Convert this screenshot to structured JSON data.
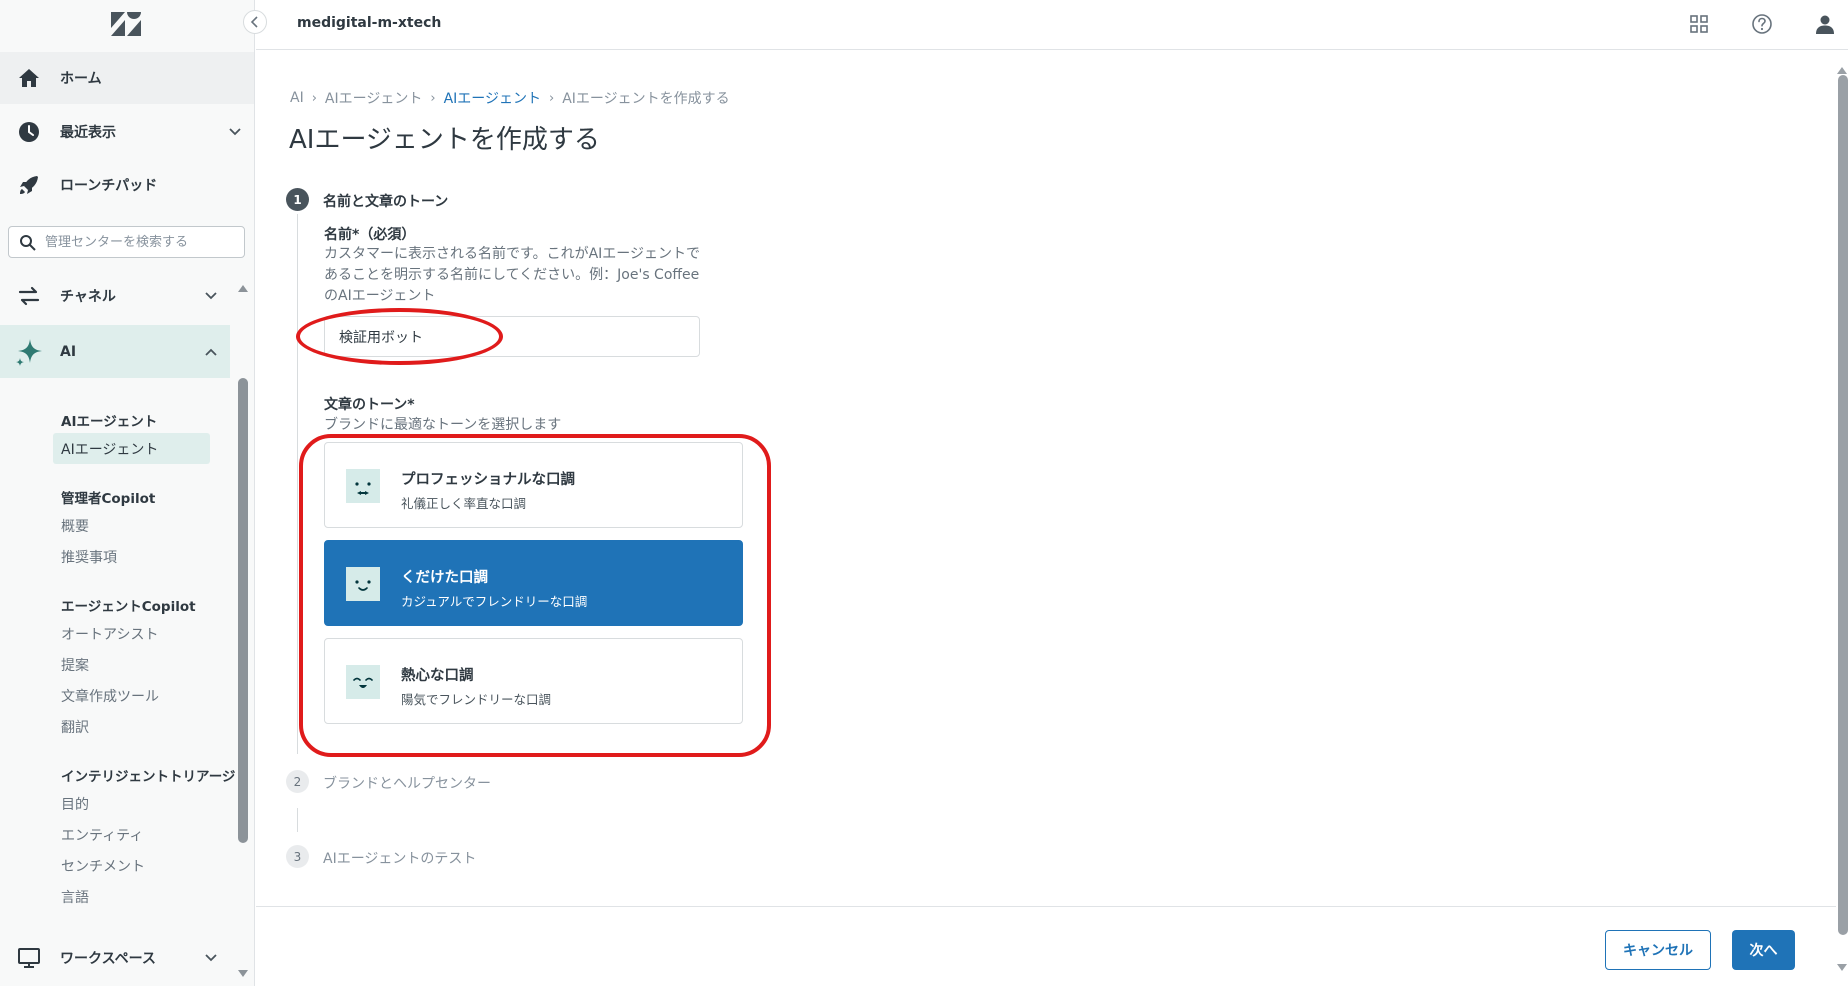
{
  "topbar": {
    "workspace_name": "medigital-m-xtech",
    "icons": [
      "grid-icon",
      "help-icon",
      "user-icon"
    ]
  },
  "sidebar": {
    "home": "ホーム",
    "recent": "最近表示",
    "launchpad": "ローンチパッド",
    "search_placeholder": "管理センターを検索する",
    "channel": "チャネル",
    "ai": "AI",
    "ai_sections": [
      {
        "heading": "AIエージェント",
        "items": [
          "AIエージェント"
        ]
      },
      {
        "heading": "管理者Copilot",
        "items": [
          "概要",
          "推奨事項"
        ]
      },
      {
        "heading": "エージェントCopilot",
        "items": [
          "オートアシスト",
          "提案",
          "文章作成ツール",
          "翻訳"
        ]
      },
      {
        "heading": "インテリジェントトリアージ",
        "items": [
          "目的",
          "エンティティ",
          "センチメント",
          "言語"
        ]
      }
    ],
    "workspace": "ワークスペース"
  },
  "breadcrumb": [
    "AI",
    "AIエージェント",
    "AIエージェント",
    "AIエージェントを作成する"
  ],
  "page_title": "AIエージェントを作成する",
  "steps": [
    {
      "num": "1",
      "label": "名前と文章のトーン"
    },
    {
      "num": "2",
      "label": "ブランドとヘルプセンター"
    },
    {
      "num": "3",
      "label": "AIエージェントのテスト"
    }
  ],
  "form": {
    "name_label": "名前*（必須）",
    "name_help_lines": [
      "カスタマーに表示される名前です。これがAIエージェントで",
      "あることを明示する名前にしてください。例：Joe's Coffee",
      "のAIエージェント"
    ],
    "name_value": "検証用ボット",
    "tone_label": "文章のトーン*",
    "tone_help": "ブランドに最適なトーンを選択します",
    "tones": [
      {
        "title": "プロフェッショナルな口調",
        "desc": "礼儀正しく率直な口調",
        "selected": false
      },
      {
        "title": "くだけた口調",
        "desc": "カジュアルでフレンドリーな口調",
        "selected": true
      },
      {
        "title": "熱心な口調",
        "desc": "陽気でフレンドリーな口調",
        "selected": false
      }
    ]
  },
  "footer": {
    "cancel": "キャンセル",
    "next": "次へ"
  },
  "colors": {
    "accent": "#1f73b7",
    "annotation": "#e01b1b",
    "ai_highlight": "#dfeeec"
  }
}
